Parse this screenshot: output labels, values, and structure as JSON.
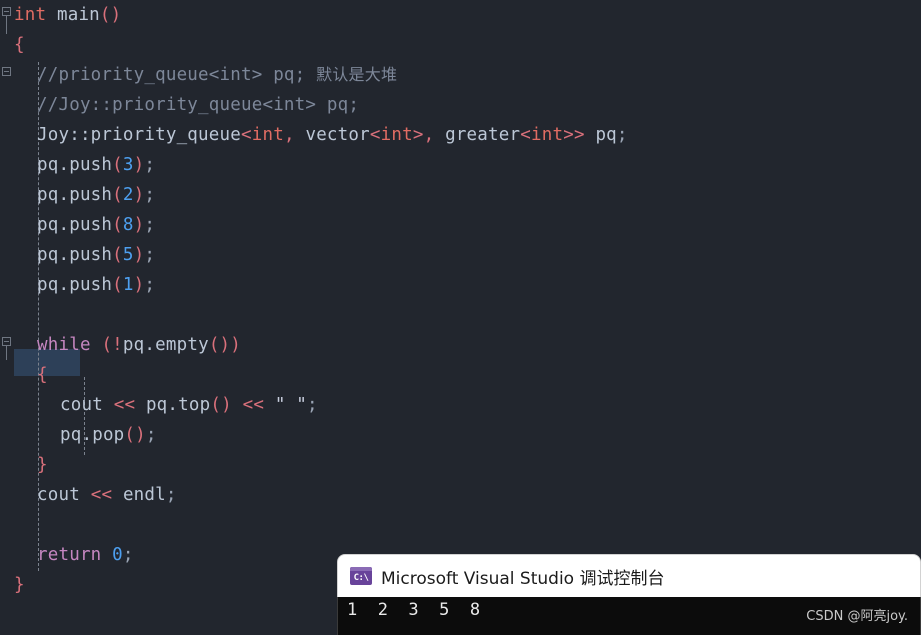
{
  "editor": {
    "background": "#22262e",
    "selection_color": "#2d4058",
    "lines": [
      {
        "n": 1,
        "indent": 0,
        "tokens": [
          {
            "c": "t-type",
            "t": "int"
          },
          {
            "c": "t-plain",
            "t": " "
          },
          {
            "c": "t-ident",
            "t": "main"
          },
          {
            "c": "t-punct",
            "t": "()"
          }
        ]
      },
      {
        "n": 2,
        "indent": 0,
        "tokens": [
          {
            "c": "t-punct",
            "t": "{"
          }
        ]
      },
      {
        "n": 3,
        "indent": 1,
        "tokens": [
          {
            "c": "t-comment",
            "t": "//priority_queue<int> pq; "
          },
          {
            "c": "t-comment cjk",
            "t": "默认是大堆"
          }
        ]
      },
      {
        "n": 4,
        "indent": 1,
        "tokens": [
          {
            "c": "t-comment",
            "t": "//Joy::priority_queue<int> pq;"
          }
        ]
      },
      {
        "n": 5,
        "indent": 1,
        "tokens": [
          {
            "c": "t-ident",
            "t": "Joy::priority_queue"
          },
          {
            "c": "t-punct",
            "t": "<"
          },
          {
            "c": "t-type",
            "t": "int"
          },
          {
            "c": "t-punct",
            "t": ","
          },
          {
            "c": "t-plain",
            "t": " "
          },
          {
            "c": "t-ident",
            "t": "vector"
          },
          {
            "c": "t-punct",
            "t": "<"
          },
          {
            "c": "t-type",
            "t": "int"
          },
          {
            "c": "t-punct",
            "t": ">,"
          },
          {
            "c": "t-plain",
            "t": " "
          },
          {
            "c": "t-ident",
            "t": "greater"
          },
          {
            "c": "t-punct",
            "t": "<"
          },
          {
            "c": "t-type",
            "t": "int"
          },
          {
            "c": "t-punct",
            "t": ">>"
          },
          {
            "c": "t-plain",
            "t": " "
          },
          {
            "c": "t-ident",
            "t": "pq"
          },
          {
            "c": "t-semi",
            "t": ";"
          }
        ]
      },
      {
        "n": 6,
        "indent": 1,
        "tokens": [
          {
            "c": "t-ident",
            "t": "pq.push"
          },
          {
            "c": "t-punct",
            "t": "("
          },
          {
            "c": "t-num",
            "t": "3"
          },
          {
            "c": "t-punct",
            "t": ")"
          },
          {
            "c": "t-semi",
            "t": ";"
          }
        ]
      },
      {
        "n": 7,
        "indent": 1,
        "tokens": [
          {
            "c": "t-ident",
            "t": "pq.push"
          },
          {
            "c": "t-punct",
            "t": "("
          },
          {
            "c": "t-num",
            "t": "2"
          },
          {
            "c": "t-punct",
            "t": ")"
          },
          {
            "c": "t-semi",
            "t": ";"
          }
        ]
      },
      {
        "n": 8,
        "indent": 1,
        "tokens": [
          {
            "c": "t-ident",
            "t": "pq.push"
          },
          {
            "c": "t-punct",
            "t": "("
          },
          {
            "c": "t-num",
            "t": "8"
          },
          {
            "c": "t-punct",
            "t": ")"
          },
          {
            "c": "t-semi",
            "t": ";"
          }
        ]
      },
      {
        "n": 9,
        "indent": 1,
        "tokens": [
          {
            "c": "t-ident",
            "t": "pq.push"
          },
          {
            "c": "t-punct",
            "t": "("
          },
          {
            "c": "t-num",
            "t": "5"
          },
          {
            "c": "t-punct",
            "t": ")"
          },
          {
            "c": "t-semi",
            "t": ";"
          }
        ]
      },
      {
        "n": 10,
        "indent": 1,
        "tokens": [
          {
            "c": "t-ident",
            "t": "pq.push"
          },
          {
            "c": "t-punct",
            "t": "("
          },
          {
            "c": "t-num",
            "t": "1"
          },
          {
            "c": "t-punct",
            "t": ")"
          },
          {
            "c": "t-semi",
            "t": ";"
          }
        ]
      },
      {
        "n": 11,
        "indent": 1,
        "tokens": []
      },
      {
        "n": 12,
        "indent": 1,
        "tokens": [
          {
            "c": "t-key",
            "t": "while"
          },
          {
            "c": "t-plain",
            "t": " "
          },
          {
            "c": "t-punct",
            "t": "(!"
          },
          {
            "c": "t-ident",
            "t": "pq.empty"
          },
          {
            "c": "t-punct",
            "t": "())"
          }
        ]
      },
      {
        "n": 13,
        "indent": 1,
        "tokens": [
          {
            "c": "t-punct",
            "t": "{"
          }
        ]
      },
      {
        "n": 14,
        "indent": 2,
        "tokens": [
          {
            "c": "t-ident",
            "t": "cout"
          },
          {
            "c": "t-plain",
            "t": " "
          },
          {
            "c": "t-op",
            "t": "<<"
          },
          {
            "c": "t-plain",
            "t": " "
          },
          {
            "c": "t-ident",
            "t": "pq.top"
          },
          {
            "c": "t-punct",
            "t": "()"
          },
          {
            "c": "t-plain",
            "t": " "
          },
          {
            "c": "t-op",
            "t": "<<"
          },
          {
            "c": "t-plain",
            "t": " "
          },
          {
            "c": "t-str",
            "t": "\" \""
          },
          {
            "c": "t-semi",
            "t": ";"
          }
        ]
      },
      {
        "n": 15,
        "indent": 2,
        "tokens": [
          {
            "c": "t-ident",
            "t": "pq.pop"
          },
          {
            "c": "t-punct",
            "t": "()"
          },
          {
            "c": "t-semi",
            "t": ";"
          }
        ]
      },
      {
        "n": 16,
        "indent": 1,
        "tokens": [
          {
            "c": "t-punct",
            "t": "}"
          }
        ]
      },
      {
        "n": 17,
        "indent": 1,
        "tokens": [
          {
            "c": "t-ident",
            "t": "cout"
          },
          {
            "c": "t-plain",
            "t": " "
          },
          {
            "c": "t-op",
            "t": "<<"
          },
          {
            "c": "t-plain",
            "t": " "
          },
          {
            "c": "t-ident",
            "t": "endl"
          },
          {
            "c": "t-semi",
            "t": ";"
          }
        ]
      },
      {
        "n": 18,
        "indent": 1,
        "tokens": []
      },
      {
        "n": 19,
        "indent": 1,
        "tokens": [
          {
            "c": "t-key",
            "t": "return"
          },
          {
            "c": "t-plain",
            "t": " "
          },
          {
            "c": "t-num",
            "t": "0"
          },
          {
            "c": "t-semi",
            "t": ";"
          }
        ]
      },
      {
        "n": 20,
        "indent": 0,
        "tokens": [
          {
            "c": "t-punct",
            "t": "}"
          }
        ]
      }
    ],
    "selected_line": 13,
    "fold_boxes": [
      1,
      3,
      12
    ],
    "plain_text": "int main()\n{\n    //priority_queue<int> pq; 默认是大堆\n    //Joy::priority_queue<int> pq;\n    Joy::priority_queue<int, vector<int>, greater<int>> pq;\n    pq.push(3);\n    pq.push(2);\n    pq.push(8);\n    pq.push(5);\n    pq.push(1);\n\n    while (!pq.empty())\n    {\n        cout << pq.top() << \" \";\n        pq.pop();\n    }\n    cout << endl;\n\n    return 0;\n}"
  },
  "console": {
    "title": "Microsoft Visual Studio 调试控制台",
    "icon_glyph": "C:\\",
    "icon_name": "console-app-icon",
    "icon_color": "#68439a",
    "titlebar_background": "#ffffff",
    "body_background": "#0c0c0c",
    "output": "1  2  3  5  8",
    "watermark": "CSDN @阿亮joy."
  }
}
